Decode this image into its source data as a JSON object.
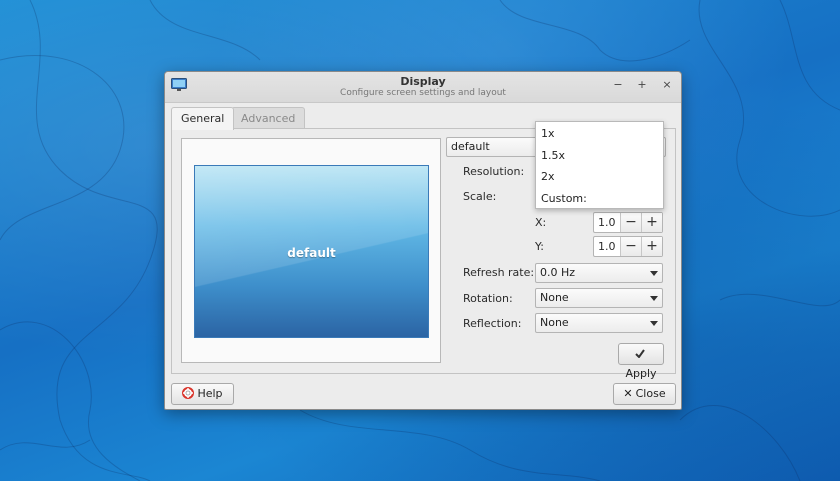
{
  "window": {
    "title": "Display",
    "subtitle": "Configure screen settings and layout",
    "controls": {
      "minimize": "−",
      "maximize": "+",
      "close": "×"
    }
  },
  "tabs": [
    {
      "label": "General",
      "active": true
    },
    {
      "label": "Advanced",
      "active": false
    }
  ],
  "preview": {
    "monitor_label": "default"
  },
  "settings": {
    "output": {
      "value": "default"
    },
    "resolution_label": "Resolution:",
    "scale_label": "Scale:",
    "x_label": "X:",
    "x_value": "1.0",
    "y_label": "Y:",
    "y_value": "1.0",
    "refresh_label": "Refresh rate:",
    "refresh_value": "0.0 Hz",
    "rotation_label": "Rotation:",
    "rotation_value": "None",
    "reflection_label": "Reflection:",
    "reflection_value": "None",
    "spin_minus": "−",
    "spin_plus": "+"
  },
  "scale_dropdown": {
    "options": [
      "1x",
      "1.5x",
      "2x",
      "Custom:"
    ]
  },
  "buttons": {
    "apply": "Apply",
    "help": "Help",
    "close": "Close"
  },
  "icons": {
    "apply": "checkmark-icon",
    "help": "lifebuoy-icon",
    "close": "x-icon",
    "app": "monitor-icon"
  },
  "colors": {
    "desktop": "#1a7fcf",
    "window_bg": "#ececec",
    "monitor_top": "#aee0f2",
    "monitor_bottom": "#2b64a4",
    "help_icon_red": "#d9342b"
  }
}
